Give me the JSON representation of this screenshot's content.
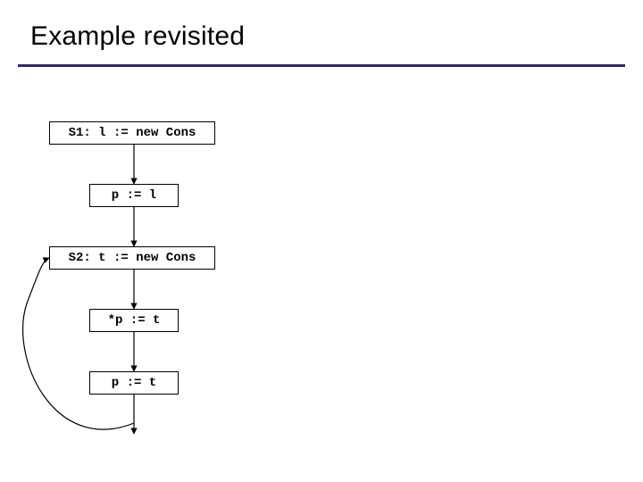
{
  "title": "Example revisited",
  "nodes": {
    "s1": "S1: l := new Cons",
    "a1": "p := l",
    "s2": "S2: t := new Cons",
    "a2": "*p := t",
    "a3": "p := t"
  }
}
